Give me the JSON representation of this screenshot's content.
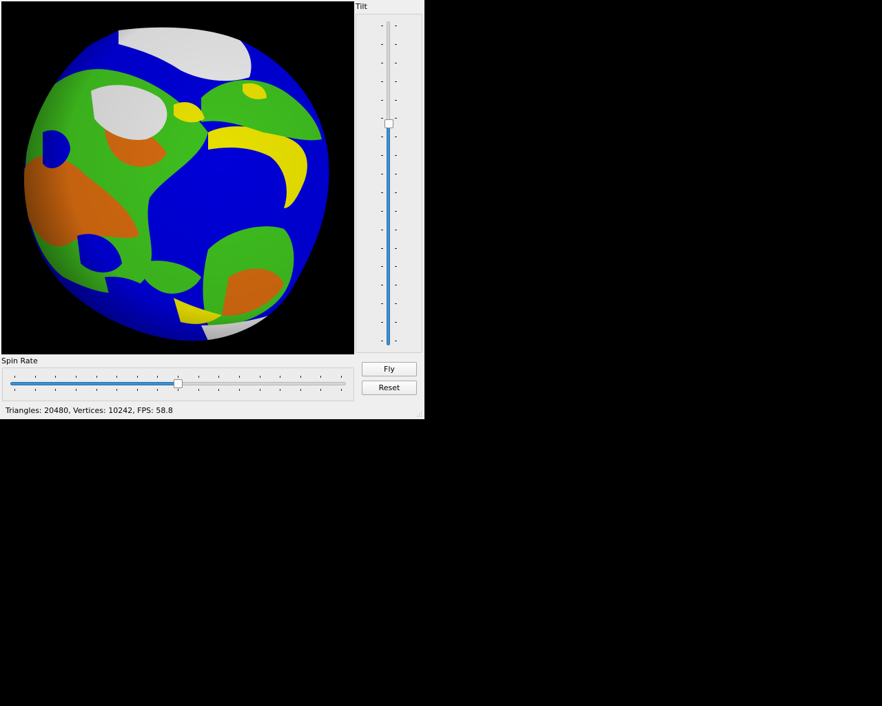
{
  "tilt": {
    "label": "Tilt",
    "value_fraction": 0.31
  },
  "spin_rate": {
    "label": "Spin Rate",
    "value_fraction": 0.5
  },
  "buttons": {
    "fly": "Fly",
    "reset": "Reset"
  },
  "status_bar": {
    "text": "Triangles: 20480, Vertices: 10242, FPS: 58.8"
  },
  "colors": {
    "ocean": "#0000d8",
    "grass": "#3fbf1f",
    "sand": "#e8e000",
    "mountain": "#d46a10",
    "snow": "#e8e8e8",
    "slider_fill": "#3d8fd1"
  }
}
